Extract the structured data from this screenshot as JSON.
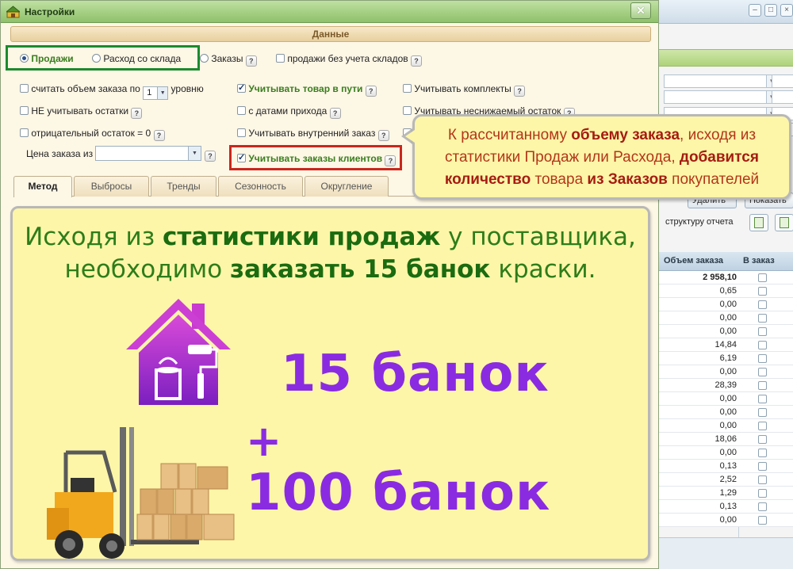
{
  "dialog": {
    "title": "Настройки",
    "close_label": "✕",
    "section_header": "Данные"
  },
  "data_source": {
    "sales": "Продажи",
    "warehouse": "Расход со склада",
    "orders": "Заказы",
    "no_warehouse": "продажи без учета складов",
    "selected": "sales"
  },
  "options": {
    "order_volume_prefix": "считать объем заказа по",
    "order_volume_level": "1",
    "order_volume_suffix": "уровню",
    "in_transit": "Учитывать товар в пути",
    "kits": "Учитывать комплекты",
    "ignore_stock": "НЕ учитывать остатки",
    "arrival_dates": "с датами прихода",
    "min_stock": "Учитывать неснижаемый остаток",
    "negative_stock": "отрицательный остаток = 0",
    "internal_order": "Учитывать внутренний заказ",
    "order_price": "Цена заказа из",
    "client_orders": "Учитывать заказы клиентов",
    "help": "?"
  },
  "checked": {
    "in_transit": true,
    "client_orders": true
  },
  "callout": {
    "p1": "К рассчитанному ",
    "b1": "объему заказа",
    "p2": ", исходя из статистики Продаж или Расхода, ",
    "b2": "добавится количество",
    "p3": " товара ",
    "b3": "из Заказов",
    "p4": " покупателей"
  },
  "tabs": [
    "Метод",
    "Выбросы",
    "Тренды",
    "Сезонность",
    "Округление"
  ],
  "active_tab": "Метод",
  "banner": {
    "p1": "Исходя из ",
    "b1": "статистики продаж",
    "p2": " у поставщика,",
    "p3": "необходимо ",
    "b2": "заказать 15 банок",
    "p4": " краски.",
    "amount1": "15 банок",
    "plus": "+",
    "amount2": "100 банок"
  },
  "background": {
    "delete_button": "Удалить",
    "show_button": "Показать",
    "report_label": "структуру отчета",
    "col_volume": "Объем заказа",
    "col_to_order": "В заказ",
    "rows": [
      "2 958,10",
      "0,65",
      "0,00",
      "0,00",
      "0,00",
      "14,84",
      "6,19",
      "0,00",
      "28,39",
      "0,00",
      "0,00",
      "0,00",
      "18,06",
      "0,00",
      "0,13",
      "2,52",
      "1,29",
      "0,13",
      "0,00"
    ]
  },
  "colors": {
    "title_green": "#8fc16a",
    "highlight_green": "#1c8a2e",
    "highlight_red": "#c9271d",
    "callout_bg": "#fdf6a8",
    "purple": "#8a2be2"
  }
}
